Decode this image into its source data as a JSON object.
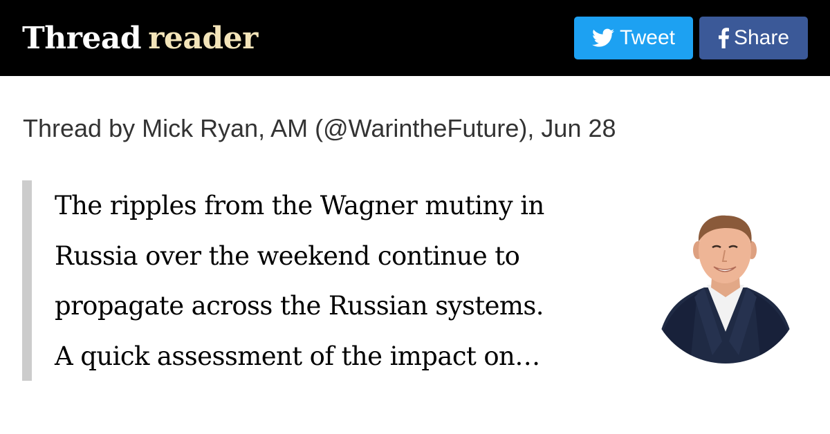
{
  "header": {
    "logo_word1": "Thread",
    "logo_word2": "reader",
    "tweet_label": "Tweet",
    "share_label": "Share",
    "tweet_icon": "twitter-bird-icon",
    "share_icon": "facebook-f-icon"
  },
  "thread": {
    "byline": "Thread by Mick Ryan, AM (@WarintheFuture), Jun 28",
    "lines": [
      "The ripples from the Wagner mutiny in",
      "Russia over the weekend continue to",
      "propagate across the Russian systems.",
      "A quick assessment of the impact on…"
    ]
  },
  "colors": {
    "topbar": "#000000",
    "logo_accent": "#f3e4b9",
    "tweet_button": "#1da1f2",
    "share_button": "#3b5998",
    "quote_bar": "#cccccc"
  }
}
